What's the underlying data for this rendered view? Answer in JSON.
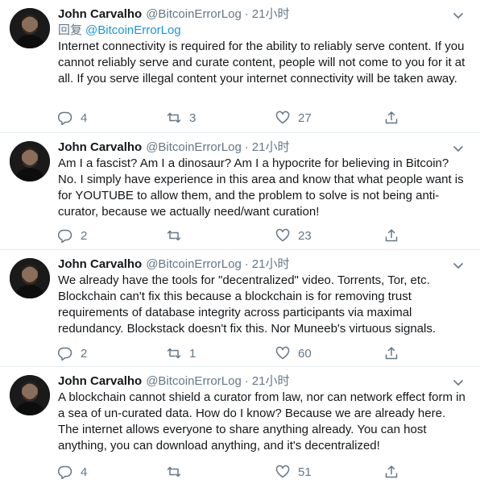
{
  "tweets": [
    {
      "name": "John Carvalho",
      "handle": "@BitcoinErrorLog",
      "separator": "·",
      "time": "21小时",
      "reply_prefix": "回复",
      "reply_to": "@BitcoinErrorLog",
      "text": "Internet connectivity is required for the ability to reliably serve content. If you cannot reliably serve and curate content, people will not come to you for it at all. If you serve illegal content your internet connectivity will be taken away.",
      "replies": "4",
      "retweets": "3",
      "likes": "27"
    },
    {
      "name": "John Carvalho",
      "handle": "@BitcoinErrorLog",
      "separator": "·",
      "time": "21小时",
      "text": "Am I a fascist? Am I a dinosaur? Am I a hypocrite for believing in Bitcoin? No. I simply have experience in this area and know that what people want is for YOUTUBE to allow them, and the problem to solve is not being anti-curator, because we actually need/want curation!",
      "replies": "2",
      "retweets": "",
      "likes": "23"
    },
    {
      "name": "John Carvalho",
      "handle": "@BitcoinErrorLog",
      "separator": "·",
      "time": "21小时",
      "text": "We already have the tools for \"decentralized\" video. Torrents, Tor, etc. Blockchain can't fix this because a blockchain is for removing trust requirements of database integrity across participants via maximal redundancy. Blockstack doesn't fix this. Nor Muneeb's virtuous signals.",
      "replies": "2",
      "retweets": "1",
      "likes": "60"
    },
    {
      "name": "John Carvalho",
      "handle": "@BitcoinErrorLog",
      "separator": "·",
      "time": "21小时",
      "text": "A blockchain cannot shield a curator from law, nor can network effect form in a sea of un-curated data. How do I know? Because we are already here. The internet allows everyone to share anything already. You can host anything, you can download anything, and it's decentralized!",
      "replies": "4",
      "retweets": "",
      "likes": "51"
    }
  ],
  "icons": {
    "reply": "reply-icon",
    "retweet": "retweet-icon",
    "like": "heart-icon",
    "share": "share-icon",
    "caret": "chevron-down-icon"
  },
  "colors": {
    "text": "#14171a",
    "secondary": "#657786",
    "link": "#1b95e0",
    "divider": "#e6ecf0"
  }
}
